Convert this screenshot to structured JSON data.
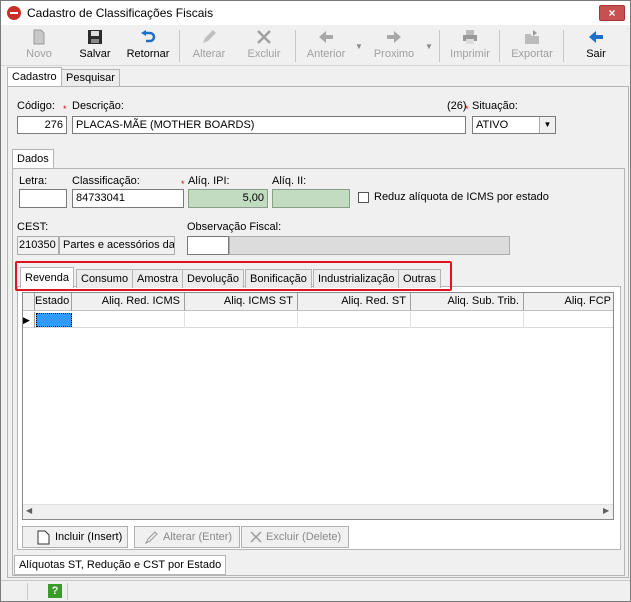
{
  "window": {
    "title": "Cadastro de Classificações Fiscais",
    "close_glyph": "×"
  },
  "toolbar": {
    "novo": "Novo",
    "salvar": "Salvar",
    "retornar": "Retornar",
    "alterar": "Alterar",
    "excluir": "Excluir",
    "anterior": "Anterior",
    "proximo": "Proximo",
    "imprimir": "Imprimir",
    "exportar": "Exportar",
    "sair": "Sair"
  },
  "tabs": {
    "cadastro": "Cadastro",
    "pesquisar": "Pesquisar",
    "dados": "Dados",
    "aliquotas": "Alíquotas ST, Redução e CST por Estado"
  },
  "form": {
    "codigo_label": "Código:",
    "codigo_value": "276",
    "descricao_label": "Descrição:",
    "descricao_value": "PLACAS-MÃE (MOTHER BOARDS)",
    "descricao_count": "(26)",
    "situacao_label": "Situação:",
    "situacao_value": "ATIVO",
    "letra_label": "Letra:",
    "letra_value": "",
    "classificacao_label": "Classificação:",
    "classificacao_value": "84733041",
    "aliq_ipi_label": "Alíq. IPI:",
    "aliq_ipi_value": "5,00",
    "aliq_ii_label": "Alíq. II:",
    "aliq_ii_value": "",
    "reduz_label": "Reduz alíquota de ICMS por estado",
    "cest_label": "CEST:",
    "cest_code": "210350",
    "cest_desc": "Partes e acessórios das",
    "obs_label": "Observação Fiscal:",
    "obs_value": ""
  },
  "subtabs": [
    "Revenda",
    "Consumo",
    "Amostra",
    "Devolução",
    "Bonificação",
    "Industrialização",
    "Outras"
  ],
  "grid": {
    "columns": [
      "Estado",
      "Aliq. Red. ICMS",
      "Aliq. ICMS ST",
      "Aliq. Red. ST",
      "Aliq. Sub. Trib.",
      "Aliq. FCP"
    ],
    "row_indicator": "▶"
  },
  "actions": {
    "incluir": "Incluir (Insert)",
    "alterar": "Alterar (Enter)",
    "excluir": "Excluir (Delete)"
  },
  "status": {
    "help_glyph": "?"
  },
  "colors": {
    "highlight_border": "#e0141e",
    "title_close": "#c75050",
    "green_field": "#c2dcc2",
    "selected_cell": "#3399ff"
  }
}
